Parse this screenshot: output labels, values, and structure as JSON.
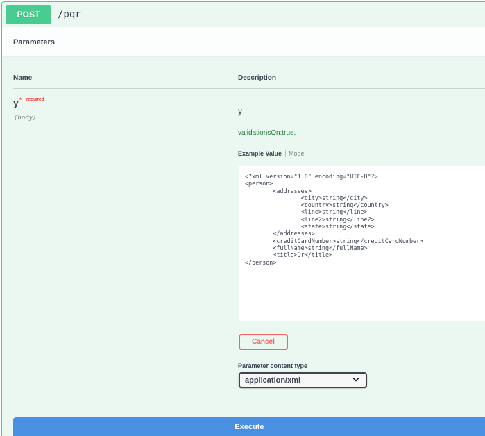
{
  "operation": {
    "method": "POST",
    "path": "/pqr"
  },
  "parameters_section": {
    "title": "Parameters",
    "col_name": "Name",
    "col_description": "Description"
  },
  "parameter": {
    "name": "y",
    "required_star": "*",
    "required_label": "required",
    "location": "(body)",
    "description": "y",
    "meta": "validationsOn:true,"
  },
  "example_tabs": {
    "active": "Example Value",
    "inactive": "Model"
  },
  "example_value": "<?xml version=\"1.0\" encoding=\"UTF-8\"?>\n<person>\n\t<addresses>\n\t\t<city>string</city>\n\t\t<country>string</country>\n\t\t<line>string</line>\n\t\t<line2>string</line2>\n\t\t<state>string</state>\n\t</addresses>\n\t<creditCardNumber>string</creditCardNumber>\n\t<fullName>string</fullName>\n\t<title>Dr</title>\n</person>",
  "cancel_label": "Cancel",
  "content_type": {
    "label": "Parameter content type",
    "selected": "application/xml"
  },
  "execute_label": "Execute",
  "icons": {
    "select_chevron": "chevron-down-icon"
  },
  "colors": {
    "post_green": "#49cc90",
    "block_bg": "#ebf7f1",
    "cancel_red": "#ff6060",
    "execute_blue": "#4990e2",
    "required_red": "#ff0000"
  }
}
